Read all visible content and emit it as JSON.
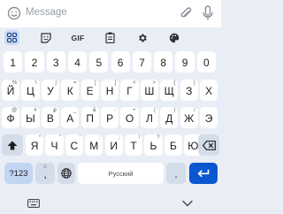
{
  "message_bar": {
    "placeholder": "Message",
    "icons": [
      "emoji-icon",
      "attach-icon",
      "mic-icon"
    ]
  },
  "toolbar": {
    "items": [
      "apps-grid-icon",
      "sticker-icon",
      "gif-button",
      "clipboard-icon",
      "settings-icon",
      "theme-icon"
    ],
    "gif_label": "GIF"
  },
  "keyboard": {
    "number_row": [
      {
        "label": "1"
      },
      {
        "label": "2"
      },
      {
        "label": "3"
      },
      {
        "label": "4"
      },
      {
        "label": "5"
      },
      {
        "label": "6"
      },
      {
        "label": "7"
      },
      {
        "label": "8"
      },
      {
        "label": "9"
      },
      {
        "label": "0"
      }
    ],
    "row1": [
      {
        "label": "Й",
        "hint": "%"
      },
      {
        "label": "Ц",
        "hint": "\\"
      },
      {
        "label": "У",
        "hint": "|"
      },
      {
        "label": "К",
        "hint": "="
      },
      {
        "label": "Е",
        "hint": "["
      },
      {
        "label": "Н",
        "hint": "]"
      },
      {
        "label": "Г",
        "hint": "<"
      },
      {
        "label": "Ш",
        "hint": ">"
      },
      {
        "label": "Щ",
        "hint": "{"
      },
      {
        "label": "З",
        "hint": "}"
      },
      {
        "label": "Х",
        "hint": ""
      }
    ],
    "row2": [
      {
        "label": "Ф",
        "hint": "@"
      },
      {
        "label": "Ы",
        "hint": "#"
      },
      {
        "label": "В",
        "hint": "₽"
      },
      {
        "label": "А",
        "hint": "_"
      },
      {
        "label": "П",
        "hint": "&"
      },
      {
        "label": "Р",
        "hint": "-"
      },
      {
        "label": "О",
        "hint": "+"
      },
      {
        "label": "Л",
        "hint": "("
      },
      {
        "label": "Д",
        "hint": ")"
      },
      {
        "label": "Ж",
        "hint": "/"
      },
      {
        "label": "Э",
        "hint": ""
      }
    ],
    "row3": [
      {
        "label": "Я",
        "hint": "*"
      },
      {
        "label": "Ч",
        "hint": "\""
      },
      {
        "label": "С",
        "hint": "'"
      },
      {
        "label": "М",
        "hint": ":"
      },
      {
        "label": "И",
        "hint": ";"
      },
      {
        "label": "Т",
        "hint": "!"
      },
      {
        "label": "Ь",
        "hint": "?"
      },
      {
        "label": "Б",
        "hint": ""
      },
      {
        "label": "Ю",
        "hint": ""
      }
    ],
    "symbols_label": "?123",
    "comma_label": ",",
    "comma_hint": "☺",
    "space_label": "Русский",
    "period_label": "."
  },
  "navigation": {
    "icons": [
      "keyboard-switch-icon",
      "hide-keyboard-icon"
    ]
  },
  "colors": {
    "background": "#e9eef6",
    "key": "#ffffff",
    "modifier_key": "#d3dce9",
    "accent": "#0b57d0",
    "accent_light": "#c2d5f2"
  }
}
